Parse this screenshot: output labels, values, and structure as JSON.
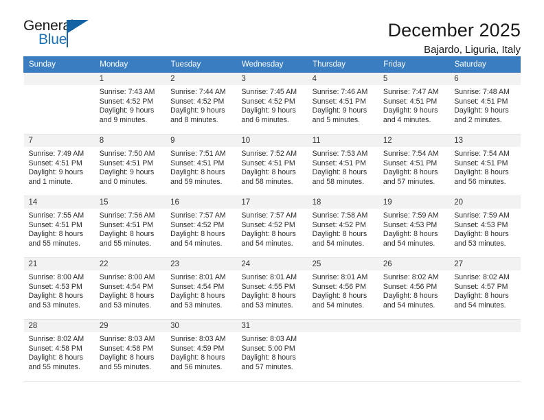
{
  "brand": {
    "name_top": "General",
    "name_bottom": "Blue",
    "accent_color": "#1464a5",
    "blue_text_color": "#1d72b8"
  },
  "header": {
    "month_title": "December 2025",
    "location": "Bajardo, Liguria, Italy",
    "header_bg": "#3b7dc1"
  },
  "weekdays": [
    "Sunday",
    "Monday",
    "Tuesday",
    "Wednesday",
    "Thursday",
    "Friday",
    "Saturday"
  ],
  "weeks": [
    [
      {
        "day": "",
        "sunrise": "",
        "sunset": "",
        "daylight_1": "",
        "daylight_2": ""
      },
      {
        "day": "1",
        "sunrise": "Sunrise: 7:43 AM",
        "sunset": "Sunset: 4:52 PM",
        "daylight_1": "Daylight: 9 hours",
        "daylight_2": "and 9 minutes."
      },
      {
        "day": "2",
        "sunrise": "Sunrise: 7:44 AM",
        "sunset": "Sunset: 4:52 PM",
        "daylight_1": "Daylight: 9 hours",
        "daylight_2": "and 8 minutes."
      },
      {
        "day": "3",
        "sunrise": "Sunrise: 7:45 AM",
        "sunset": "Sunset: 4:52 PM",
        "daylight_1": "Daylight: 9 hours",
        "daylight_2": "and 6 minutes."
      },
      {
        "day": "4",
        "sunrise": "Sunrise: 7:46 AM",
        "sunset": "Sunset: 4:51 PM",
        "daylight_1": "Daylight: 9 hours",
        "daylight_2": "and 5 minutes."
      },
      {
        "day": "5",
        "sunrise": "Sunrise: 7:47 AM",
        "sunset": "Sunset: 4:51 PM",
        "daylight_1": "Daylight: 9 hours",
        "daylight_2": "and 4 minutes."
      },
      {
        "day": "6",
        "sunrise": "Sunrise: 7:48 AM",
        "sunset": "Sunset: 4:51 PM",
        "daylight_1": "Daylight: 9 hours",
        "daylight_2": "and 2 minutes."
      }
    ],
    [
      {
        "day": "7",
        "sunrise": "Sunrise: 7:49 AM",
        "sunset": "Sunset: 4:51 PM",
        "daylight_1": "Daylight: 9 hours",
        "daylight_2": "and 1 minute."
      },
      {
        "day": "8",
        "sunrise": "Sunrise: 7:50 AM",
        "sunset": "Sunset: 4:51 PM",
        "daylight_1": "Daylight: 9 hours",
        "daylight_2": "and 0 minutes."
      },
      {
        "day": "9",
        "sunrise": "Sunrise: 7:51 AM",
        "sunset": "Sunset: 4:51 PM",
        "daylight_1": "Daylight: 8 hours",
        "daylight_2": "and 59 minutes."
      },
      {
        "day": "10",
        "sunrise": "Sunrise: 7:52 AM",
        "sunset": "Sunset: 4:51 PM",
        "daylight_1": "Daylight: 8 hours",
        "daylight_2": "and 58 minutes."
      },
      {
        "day": "11",
        "sunrise": "Sunrise: 7:53 AM",
        "sunset": "Sunset: 4:51 PM",
        "daylight_1": "Daylight: 8 hours",
        "daylight_2": "and 58 minutes."
      },
      {
        "day": "12",
        "sunrise": "Sunrise: 7:54 AM",
        "sunset": "Sunset: 4:51 PM",
        "daylight_1": "Daylight: 8 hours",
        "daylight_2": "and 57 minutes."
      },
      {
        "day": "13",
        "sunrise": "Sunrise: 7:54 AM",
        "sunset": "Sunset: 4:51 PM",
        "daylight_1": "Daylight: 8 hours",
        "daylight_2": "and 56 minutes."
      }
    ],
    [
      {
        "day": "14",
        "sunrise": "Sunrise: 7:55 AM",
        "sunset": "Sunset: 4:51 PM",
        "daylight_1": "Daylight: 8 hours",
        "daylight_2": "and 55 minutes."
      },
      {
        "day": "15",
        "sunrise": "Sunrise: 7:56 AM",
        "sunset": "Sunset: 4:51 PM",
        "daylight_1": "Daylight: 8 hours",
        "daylight_2": "and 55 minutes."
      },
      {
        "day": "16",
        "sunrise": "Sunrise: 7:57 AM",
        "sunset": "Sunset: 4:52 PM",
        "daylight_1": "Daylight: 8 hours",
        "daylight_2": "and 54 minutes."
      },
      {
        "day": "17",
        "sunrise": "Sunrise: 7:57 AM",
        "sunset": "Sunset: 4:52 PM",
        "daylight_1": "Daylight: 8 hours",
        "daylight_2": "and 54 minutes."
      },
      {
        "day": "18",
        "sunrise": "Sunrise: 7:58 AM",
        "sunset": "Sunset: 4:52 PM",
        "daylight_1": "Daylight: 8 hours",
        "daylight_2": "and 54 minutes."
      },
      {
        "day": "19",
        "sunrise": "Sunrise: 7:59 AM",
        "sunset": "Sunset: 4:53 PM",
        "daylight_1": "Daylight: 8 hours",
        "daylight_2": "and 54 minutes."
      },
      {
        "day": "20",
        "sunrise": "Sunrise: 7:59 AM",
        "sunset": "Sunset: 4:53 PM",
        "daylight_1": "Daylight: 8 hours",
        "daylight_2": "and 53 minutes."
      }
    ],
    [
      {
        "day": "21",
        "sunrise": "Sunrise: 8:00 AM",
        "sunset": "Sunset: 4:53 PM",
        "daylight_1": "Daylight: 8 hours",
        "daylight_2": "and 53 minutes."
      },
      {
        "day": "22",
        "sunrise": "Sunrise: 8:00 AM",
        "sunset": "Sunset: 4:54 PM",
        "daylight_1": "Daylight: 8 hours",
        "daylight_2": "and 53 minutes."
      },
      {
        "day": "23",
        "sunrise": "Sunrise: 8:01 AM",
        "sunset": "Sunset: 4:54 PM",
        "daylight_1": "Daylight: 8 hours",
        "daylight_2": "and 53 minutes."
      },
      {
        "day": "24",
        "sunrise": "Sunrise: 8:01 AM",
        "sunset": "Sunset: 4:55 PM",
        "daylight_1": "Daylight: 8 hours",
        "daylight_2": "and 53 minutes."
      },
      {
        "day": "25",
        "sunrise": "Sunrise: 8:01 AM",
        "sunset": "Sunset: 4:56 PM",
        "daylight_1": "Daylight: 8 hours",
        "daylight_2": "and 54 minutes."
      },
      {
        "day": "26",
        "sunrise": "Sunrise: 8:02 AM",
        "sunset": "Sunset: 4:56 PM",
        "daylight_1": "Daylight: 8 hours",
        "daylight_2": "and 54 minutes."
      },
      {
        "day": "27",
        "sunrise": "Sunrise: 8:02 AM",
        "sunset": "Sunset: 4:57 PM",
        "daylight_1": "Daylight: 8 hours",
        "daylight_2": "and 54 minutes."
      }
    ],
    [
      {
        "day": "28",
        "sunrise": "Sunrise: 8:02 AM",
        "sunset": "Sunset: 4:58 PM",
        "daylight_1": "Daylight: 8 hours",
        "daylight_2": "and 55 minutes."
      },
      {
        "day": "29",
        "sunrise": "Sunrise: 8:03 AM",
        "sunset": "Sunset: 4:58 PM",
        "daylight_1": "Daylight: 8 hours",
        "daylight_2": "and 55 minutes."
      },
      {
        "day": "30",
        "sunrise": "Sunrise: 8:03 AM",
        "sunset": "Sunset: 4:59 PM",
        "daylight_1": "Daylight: 8 hours",
        "daylight_2": "and 56 minutes."
      },
      {
        "day": "31",
        "sunrise": "Sunrise: 8:03 AM",
        "sunset": "Sunset: 5:00 PM",
        "daylight_1": "Daylight: 8 hours",
        "daylight_2": "and 57 minutes."
      },
      {
        "day": "",
        "sunrise": "",
        "sunset": "",
        "daylight_1": "",
        "daylight_2": ""
      },
      {
        "day": "",
        "sunrise": "",
        "sunset": "",
        "daylight_1": "",
        "daylight_2": ""
      },
      {
        "day": "",
        "sunrise": "",
        "sunset": "",
        "daylight_1": "",
        "daylight_2": ""
      }
    ]
  ]
}
